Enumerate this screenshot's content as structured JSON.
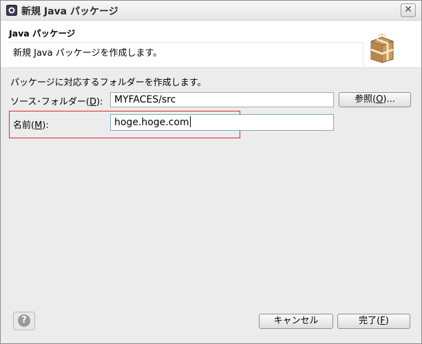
{
  "window": {
    "title": "新規 Java パッケージ",
    "close_label": "✕"
  },
  "header": {
    "title": "Java パッケージ",
    "message": "新規 Java パッケージを作成します。"
  },
  "form": {
    "description": "パッケージに対応するフォルダーを作成します。",
    "source_folder": {
      "label_pre": "ソース･フォルダー(",
      "label_key": "D",
      "label_post": "):",
      "value": "MYFACES/src"
    },
    "browse_button": {
      "label_pre": "参照(",
      "label_key": "O",
      "label_post": ")..."
    },
    "name": {
      "label_pre": "名前(",
      "label_key": "M",
      "label_post": "):",
      "value": "hoge.hoge.com"
    }
  },
  "footer": {
    "help_glyph": "?",
    "cancel_label": "キャンセル",
    "finish": {
      "label_pre": "完了(",
      "label_key": "F",
      "label_post": ")"
    }
  },
  "colors": {
    "highlight_box": "#e0202a",
    "background": "#ececec"
  },
  "icons": [
    "eclipse-app-icon",
    "close-icon",
    "package-icon",
    "help-icon"
  ]
}
